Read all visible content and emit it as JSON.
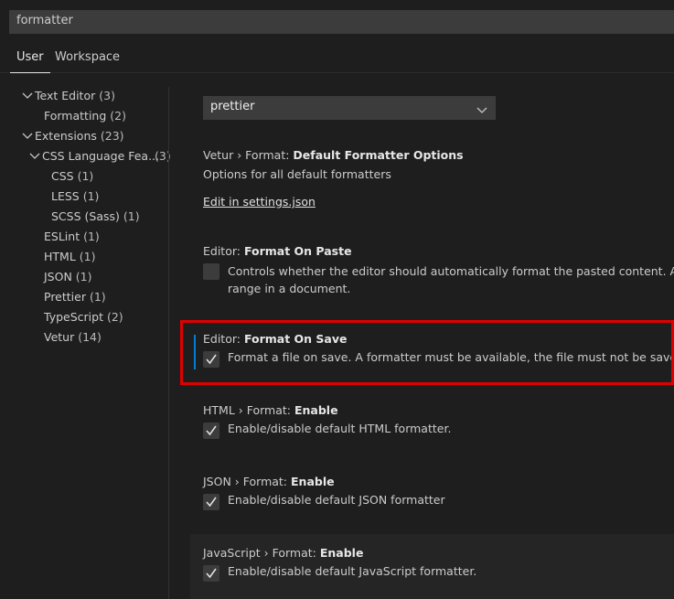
{
  "search": {
    "value": "formatter"
  },
  "tabs": [
    {
      "label": "User"
    },
    {
      "label": "Workspace"
    }
  ],
  "sidebar": {
    "items": [
      {
        "label": "Text Editor",
        "count": "(3)"
      },
      {
        "label": "Formatting",
        "count": "(2)"
      },
      {
        "label": "Extensions",
        "count": "(23)"
      },
      {
        "label": "CSS Language Fea...",
        "count": "(3)"
      },
      {
        "label": "CSS",
        "count": "(1)"
      },
      {
        "label": "LESS",
        "count": "(1)"
      },
      {
        "label": "SCSS (Sass)",
        "count": "(1)"
      },
      {
        "label": "ESLint",
        "count": "(1)"
      },
      {
        "label": "HTML",
        "count": "(1)"
      },
      {
        "label": "JSON",
        "count": "(1)"
      },
      {
        "label": "Prettier",
        "count": "(1)"
      },
      {
        "label": "TypeScript",
        "count": "(2)"
      },
      {
        "label": "Vetur",
        "count": "(14)"
      }
    ]
  },
  "settings": {
    "formatter_select": {
      "value": "prettier"
    },
    "vetur_options": {
      "prefix": "Vetur › Format: ",
      "name": "Default Formatter Options",
      "desc": "Options for all default formatters",
      "link": "Edit in settings.json"
    },
    "format_on_paste": {
      "prefix": "Editor: ",
      "name": "Format On Paste",
      "desc_line1": "Controls whether the editor should automatically format the pasted content. A formatter",
      "desc_line2": "range in a document.",
      "checked": false
    },
    "format_on_save": {
      "prefix": "Editor: ",
      "name": "Format On Save",
      "desc": "Format a file on save. A formatter must be available, the file must not be saved after delay,",
      "checked": true
    },
    "html_format": {
      "prefix": "HTML › Format: ",
      "name": "Enable",
      "desc": "Enable/disable default HTML formatter.",
      "checked": true
    },
    "json_format": {
      "prefix": "JSON › Format: ",
      "name": "Enable",
      "desc": "Enable/disable default JSON formatter",
      "checked": true
    },
    "js_format": {
      "prefix": "JavaScript › Format: ",
      "name": "Enable",
      "desc": "Enable/disable default JavaScript formatter.",
      "checked": true
    }
  },
  "colors": {
    "background": "#1e1e1e",
    "input_background": "#3c3c3c",
    "focus_accent": "#007fd4",
    "highlight_box": "#e00000"
  }
}
